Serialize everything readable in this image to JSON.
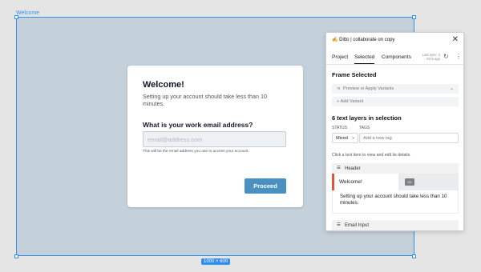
{
  "canvas": {
    "frame_label": "Welcome",
    "size_badge": "1000 × 600"
  },
  "modal": {
    "title": "Welcome!",
    "subtitle": "Setting up your account should take less than 10 minutes.",
    "question": "What is your work email address?",
    "email_placeholder": "email@address.com",
    "hint": "This will be the email address you use to access your account.",
    "proceed_label": "Proceed"
  },
  "plugin": {
    "title": "✍️ Ditto | collaborate on copy",
    "tabs": [
      {
        "label": "Project",
        "active": false
      },
      {
        "label": "Selected",
        "active": true
      },
      {
        "label": "Components",
        "active": false
      }
    ],
    "last_sync": "Last sync: 4 mins ago",
    "frame_selected_title": "Frame Selected",
    "preview_variants_label": "Preview or Apply Variants",
    "add_variant_label": "+ Add Variant",
    "layers_title": "6 text layers in selection",
    "status_label": "STATUS",
    "tags_label": "TAGS",
    "status_value": "Mixed",
    "tags_placeholder": "Add a new tag",
    "click_hint": "Click a text item to view and edit its details.",
    "groups": [
      {
        "name": "Header"
      },
      {
        "name": "Email Input"
      }
    ],
    "selected_item": {
      "text": "Welcome!",
      "tag": "H1"
    },
    "next_item_text": "Setting up your account should take less than 10 minutes."
  },
  "colors": {
    "accent_blue": "#2f8ff3",
    "proceed_button": "#4a90c2",
    "selected_bar": "#e2533e",
    "frame_fill": "#c4d0da"
  }
}
